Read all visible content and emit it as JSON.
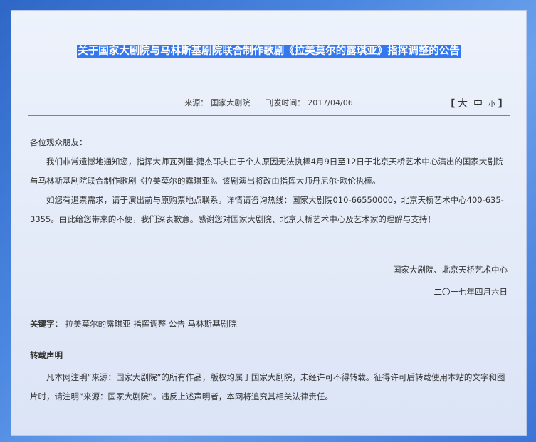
{
  "article": {
    "title": "关于国家大剧院与马林斯基剧院联合制作歌剧《拉美莫尔的露琪亚》指挥调整的公告",
    "meta": {
      "source_label": "来源：",
      "source": "国家大剧院",
      "date_label": "刊发时间：",
      "date": "2017/04/06"
    },
    "font_size": {
      "open_bracket": "【",
      "large": "大",
      "medium": "中",
      "small": "小",
      "close_bracket": "】"
    },
    "greeting": "各位观众朋友：",
    "paragraphs": [
      "我们非常遗憾地通知您，指挥大师瓦列里·捷杰耶夫由于个人原因无法执棒4月9日至12日于北京天桥艺术中心演出的国家大剧院与马林斯基剧院联合制作歌剧《拉美莫尔的露琪亚》。该剧演出将改由指挥大师丹尼尔·欧伦执棒。",
      "如您有退票需求，请于演出前与原购票地点联系。详情请咨询热线：国家大剧院010-66550000，北京天桥艺术中心400-635-3355。由此给您带来的不便，我们深表歉意。感谢您对国家大剧院、北京天桥艺术中心及艺术家的理解与支持！"
    ],
    "signature": "国家大剧院、北京天桥艺术中心",
    "sign_date": "二〇一七年四月六日",
    "keywords_label": "关键字：",
    "keywords": "拉美莫尔的露琪亚 指挥调整 公告 马林斯基剧院"
  },
  "repost": {
    "title": "转载声明",
    "text": "凡本网注明“来源：国家大剧院”的所有作品，版权均属于国家大剧院，未经许可不得转载。征得许可后转载使用本站的文字和图片时，请注明“来源：国家大剧院”。违反上述声明者，本网将追究其相关法律责任。"
  },
  "colors": {
    "title_highlight": "#3478f0",
    "divider": "#5b86cf",
    "background": "#3c74d6"
  }
}
